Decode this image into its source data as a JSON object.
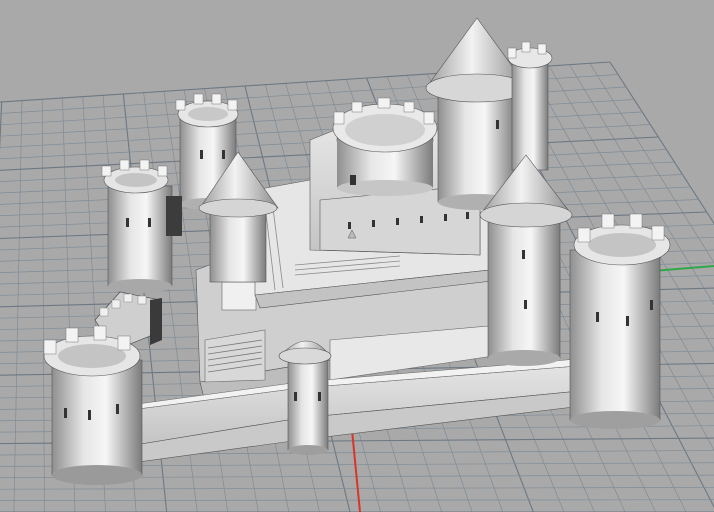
{
  "viewport": {
    "background_color": "#a9a9a9",
    "grid_color": "#7f8c97",
    "grid_major_color": "#6c7884",
    "axis_x_color": "#d9342b",
    "axis_y_color": "#2fa84a"
  },
  "model": {
    "light_color": "#f4f4f4",
    "mid_color": "#c9c9c9",
    "shadow_color": "#8e8e8e",
    "outline_color": "#3a3a3a"
  }
}
